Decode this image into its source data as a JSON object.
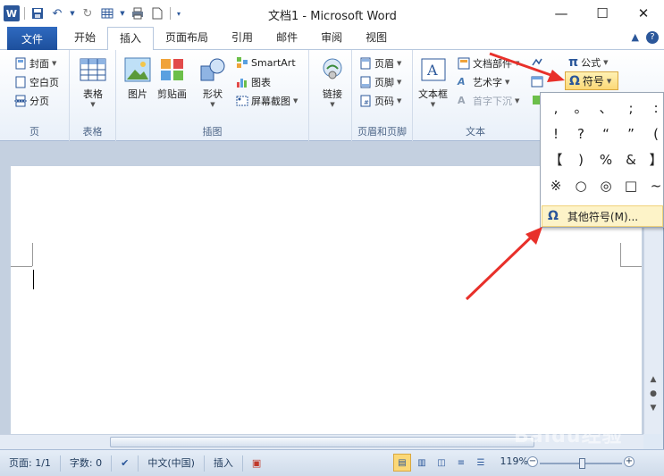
{
  "window": {
    "title": "文档1 - Microsoft Word",
    "controls": [
      "—",
      "☐",
      "✕"
    ]
  },
  "tabs": {
    "file": "文件",
    "items": [
      "开始",
      "插入",
      "页面布局",
      "引用",
      "邮件",
      "审阅",
      "视图"
    ],
    "active": "插入"
  },
  "ribbon": {
    "pages": {
      "cover": "封面",
      "blank": "空白页",
      "break": "分页",
      "label": "页"
    },
    "tables": {
      "table": "表格",
      "label": "表格"
    },
    "illustrations": {
      "picture": "图片",
      "clipart": "剪贴画",
      "shapes": "形状",
      "smartart": "SmartArt",
      "chart": "图表",
      "screenshot": "屏幕截图",
      "label": "插图"
    },
    "links": {
      "link": "链接"
    },
    "header_footer": {
      "header": "页眉",
      "footer": "页脚",
      "page_number": "页码",
      "label": "页眉和页脚"
    },
    "text": {
      "textbox": "文本框",
      "quickparts": "文档部件",
      "wordart": "艺术字",
      "dropcap": "首字下沉",
      "label": "文本"
    },
    "symbols": {
      "equation": "公式",
      "symbol": "符号"
    }
  },
  "symbol_menu": {
    "symbols": [
      ",",
      "。",
      "、",
      ";",
      ":",
      "!",
      "?",
      "“",
      "”",
      "(",
      "【",
      ")",
      "%",
      "&",
      "】",
      "※",
      "○",
      "◎",
      "□",
      "~"
    ],
    "more": "其他符号(M)..."
  },
  "status": {
    "page": "页面: 1/1",
    "words": "字数: 0",
    "language": "中文(中国)",
    "mode": "插入",
    "zoom": "119%"
  },
  "watermark": "Baidu经验",
  "colors": {
    "accent": "#2b579a",
    "highlight": "#fbd877",
    "arrow": "#e8302a"
  }
}
